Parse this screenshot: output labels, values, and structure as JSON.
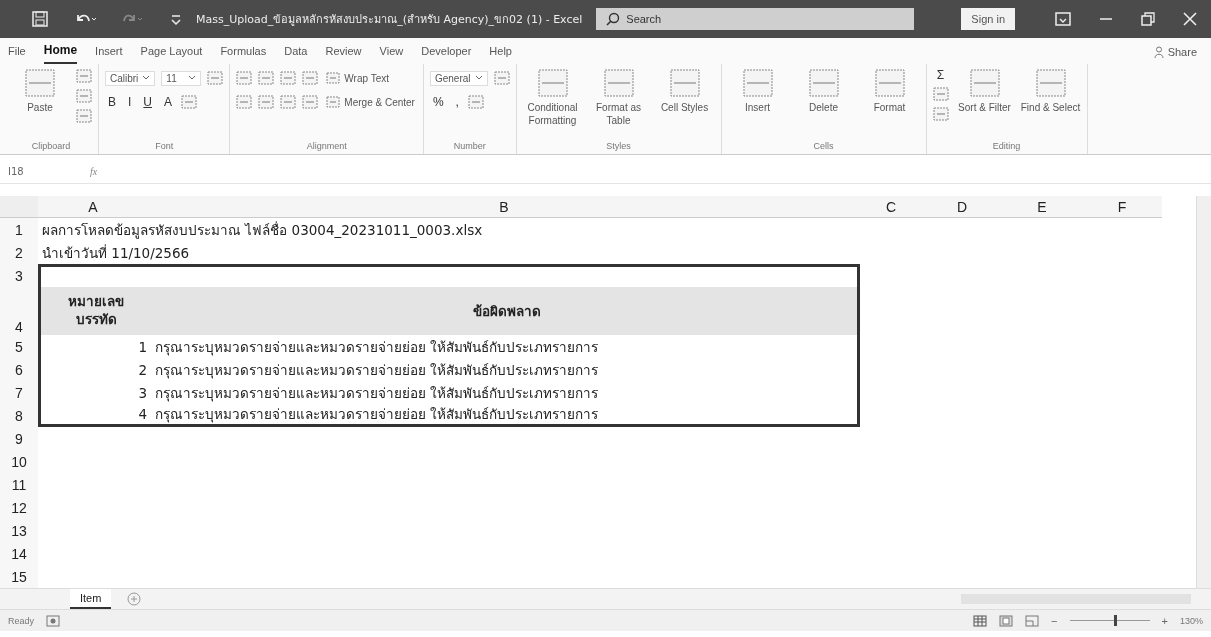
{
  "window": {
    "title": "Mass_Upload_ข้อมูลหลักรหัสงบประมาณ_(สำหรับ Agency)_ขก02 (1) - Excel",
    "search_placeholder": "Search",
    "sign_in": "Sign in"
  },
  "ribbon_tabs": [
    {
      "label": "File",
      "selected": false
    },
    {
      "label": "Home",
      "selected": true
    },
    {
      "label": "Insert",
      "selected": false
    },
    {
      "label": "Page Layout",
      "selected": false
    },
    {
      "label": "Formulas",
      "selected": false
    },
    {
      "label": "Data",
      "selected": false
    },
    {
      "label": "Review",
      "selected": false
    },
    {
      "label": "View",
      "selected": false
    },
    {
      "label": "Developer",
      "selected": false
    },
    {
      "label": "Help",
      "selected": false
    }
  ],
  "share": "Share",
  "ribbon_groups": [
    {
      "label": "Clipboard",
      "blocks": [
        {
          "kind": "large",
          "label": "Paste"
        },
        {
          "kind": "icons"
        }
      ]
    },
    {
      "label": "Font",
      "blocks": [
        {
          "kind": "lines",
          "lines": [
            {
              "fields": [
                "Calibri",
                "11"
              ]
            },
            {
              "buttons": [
                {
                  "kind": "bold",
                  "text": "B"
                },
                {
                  "kind": "italic",
                  "text": "I"
                },
                {
                  "kind": "underline",
                  "text": "U"
                },
                {
                  "kind": "color",
                  "text": "A"
                }
              ]
            }
          ]
        }
      ]
    },
    {
      "label": "Alignment",
      "blocks": [
        {
          "kind": "lines",
          "lines": [
            {
              "small": "Wrap Text"
            },
            {
              "small": "Merge & Center"
            }
          ]
        }
      ]
    },
    {
      "label": "Number",
      "blocks": [
        {
          "kind": "lines",
          "lines": [
            {
              "fields": [
                "General"
              ]
            },
            {
              "buttons": [
                {
                  "kind": "percent",
                  "text": "%"
                },
                {
                  "kind": "comma",
                  "text": ","
                }
              ]
            }
          ]
        }
      ]
    },
    {
      "label": "Styles",
      "blocks": [
        {
          "kind": "large",
          "label": "Conditional Formatting"
        },
        {
          "kind": "large",
          "label": "Format as Table"
        },
        {
          "kind": "large",
          "label": "Cell Styles"
        }
      ]
    },
    {
      "label": "Cells",
      "blocks": [
        {
          "kind": "large",
          "label": "Insert"
        },
        {
          "kind": "large",
          "label": "Delete"
        },
        {
          "kind": "large",
          "label": "Format"
        }
      ]
    },
    {
      "label": "Editing",
      "blocks": [
        {
          "kind": "sum",
          "text": "Σ"
        },
        {
          "kind": "large",
          "label": "Sort & Filter"
        },
        {
          "kind": "large",
          "label": "Find & Select"
        }
      ]
    }
  ],
  "formula_bar": {
    "name_box": "I18",
    "fx": "fx"
  },
  "sheet": {
    "columns": [
      "A",
      "B",
      "C",
      "D",
      "E",
      "F"
    ],
    "rows": [
      {
        "number": "1",
        "kind": "title",
        "boxed": false,
        "a": "ผลการโหลดข้อมูลรหัสงบประมาณ ไฟล์ชื่อ 03004_20231011_0003.xlsx"
      },
      {
        "number": "2",
        "kind": "title",
        "boxed": false,
        "a": "นำเข้าวันที่ 11/10/2566"
      },
      {
        "number": "3",
        "kind": "empty",
        "boxed": true
      },
      {
        "number": "4",
        "kind": "header",
        "boxed": true,
        "a": "หมายเลข บรรทัด",
        "b": "ข้อผิดพลาด"
      },
      {
        "number": "5",
        "kind": "data",
        "boxed": true,
        "a": "1",
        "b": "กรุณาระบุหมวดรายจ่ายและหมวดรายจ่ายย่อย ให้สัมพันธ์กับประเภทรายการ"
      },
      {
        "number": "6",
        "kind": "data",
        "boxed": true,
        "a": "2",
        "b": "กรุณาระบุหมวดรายจ่ายและหมวดรายจ่ายย่อย ให้สัมพันธ์กับประเภทรายการ"
      },
      {
        "number": "7",
        "kind": "data",
        "boxed": true,
        "a": "3",
        "b": "กรุณาระบุหมวดรายจ่ายและหมวดรายจ่ายย่อย ให้สัมพันธ์กับประเภทรายการ"
      },
      {
        "number": "8",
        "kind": "data",
        "boxed": true,
        "a": "4",
        "b": "กรุณาระบุหมวดรายจ่ายและหมวดรายจ่ายย่อย ให้สัมพันธ์กับประเภทรายการ"
      },
      {
        "number": "9",
        "kind": "empty",
        "boxed": false
      },
      {
        "number": "10",
        "kind": "empty",
        "boxed": false
      },
      {
        "number": "11",
        "kind": "empty",
        "boxed": false
      },
      {
        "number": "12",
        "kind": "empty",
        "boxed": false
      },
      {
        "number": "13",
        "kind": "empty",
        "boxed": false
      },
      {
        "number": "14",
        "kind": "empty",
        "boxed": false
      },
      {
        "number": "15",
        "kind": "empty",
        "boxed": false
      }
    ]
  },
  "sheet_tabs": [
    {
      "label": "Item",
      "selected": true
    }
  ],
  "status_bar": {
    "status": "Ready",
    "zoom": {
      "out": "−",
      "in": "+",
      "level": 0.55,
      "reading": "130%"
    }
  }
}
